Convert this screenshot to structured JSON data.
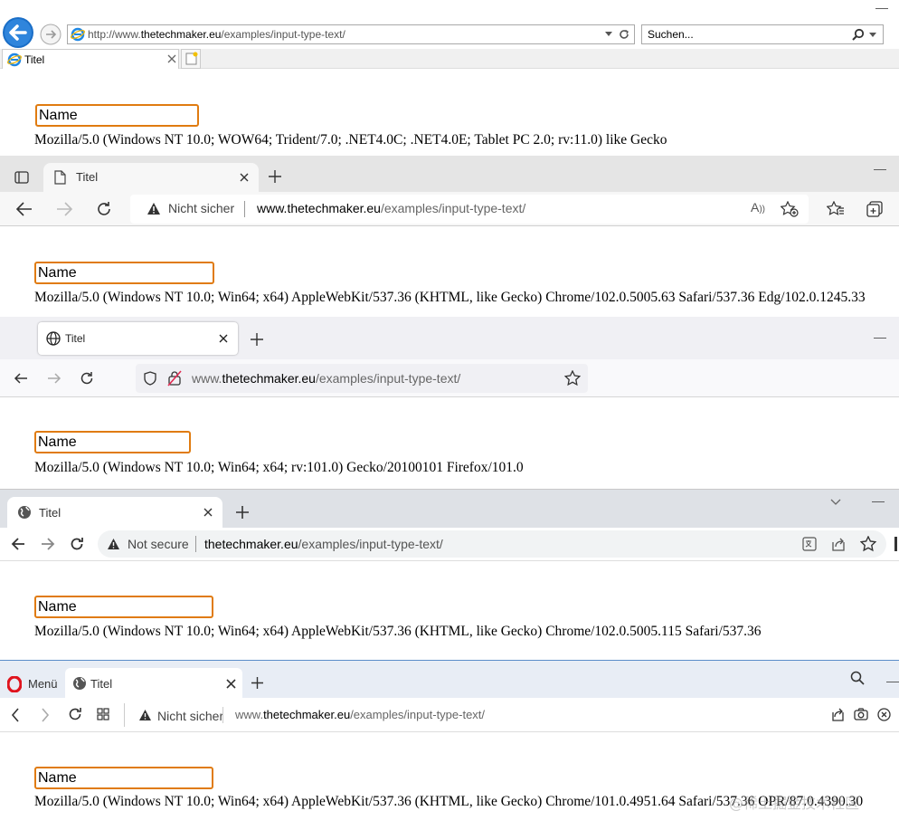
{
  "page": {
    "field_value": "Name"
  },
  "ie": {
    "url_prefix": "http://www.",
    "url_domain": "thetechmaker.eu",
    "url_path": "/examples/input-type-text/",
    "search_placeholder": "Suchen...",
    "tab_title": "Titel",
    "user_agent": "Mozilla/5.0 (Windows NT 10.0; WOW64; Trident/7.0; .NET4.0C; .NET4.0E; Tablet PC 2.0; rv:11.0) like Gecko"
  },
  "edge": {
    "tab_title": "Titel",
    "security_label": "Nicht sicher",
    "url_domain": "www.thetechmaker.eu",
    "url_path": "/examples/input-type-text/",
    "user_agent": "Mozilla/5.0 (Windows NT 10.0; Win64; x64) AppleWebKit/537.36 (KHTML, like Gecko) Chrome/102.0.5005.63 Safari/537.36 Edg/102.0.1245.33"
  },
  "firefox": {
    "tab_title": "Titel",
    "url_prefix": "www.",
    "url_domain": "thetechmaker.eu",
    "url_path": "/examples/input-type-text/",
    "user_agent": "Mozilla/5.0 (Windows NT 10.0; Win64; x64; rv:101.0) Gecko/20100101 Firefox/101.0"
  },
  "chrome": {
    "tab_title": "Titel",
    "security_label": "Not secure",
    "url_domain": "thetechmaker.eu",
    "url_path": "/examples/input-type-text/",
    "user_agent": "Mozilla/5.0 (Windows NT 10.0; Win64; x64) AppleWebKit/537.36 (KHTML, like Gecko) Chrome/102.0.5005.115 Safari/537.36"
  },
  "opera": {
    "menu_label": "Menü",
    "tab_title": "Titel",
    "security_label": "Nicht sicher",
    "url_prefix": "www.",
    "url_domain": "thetechmaker.eu",
    "url_path": "/examples/input-type-text/",
    "user_agent": "Mozilla/5.0 (Windows NT 10.0; Win64; x64) AppleWebKit/537.36 (KHTML, like Gecko) Chrome/101.0.4951.64 Safari/537.36 OPR/87.0.4390.30",
    "watermark": "@稀土掘金技术社区"
  },
  "colors": {
    "input_border": "#e07b10",
    "ie_back_button": "#1a6ec7",
    "opera_red": "#e0141e"
  },
  "icons": {
    "ie": [
      "back-icon",
      "forward-icon",
      "ie-logo-icon",
      "dropdown-icon",
      "refresh-icon",
      "search-icon",
      "close-icon",
      "new-tab-icon"
    ],
    "edge": [
      "tab-actions-icon",
      "page-icon",
      "close-icon",
      "plus-icon",
      "back-icon",
      "forward-icon",
      "refresh-icon",
      "warning-icon",
      "read-aloud-icon",
      "add-favorite-icon",
      "favorites-icon",
      "collections-icon"
    ],
    "firefox": [
      "globe-icon",
      "close-icon",
      "plus-icon",
      "back-icon",
      "forward-icon",
      "refresh-icon",
      "shield-icon",
      "insecure-lock-icon",
      "star-icon"
    ],
    "chrome": [
      "globe-icon",
      "close-icon",
      "plus-icon",
      "chevron-down-icon",
      "back-icon",
      "forward-icon",
      "refresh-icon",
      "warning-icon",
      "translate-icon",
      "share-icon",
      "star-icon"
    ],
    "opera": [
      "opera-logo-icon",
      "globe-icon",
      "close-icon",
      "plus-icon",
      "search-icon",
      "back-icon",
      "forward-icon",
      "refresh-icon",
      "grid-icon",
      "warning-icon",
      "share-icon",
      "camera-icon",
      "wallet-icon"
    ]
  }
}
